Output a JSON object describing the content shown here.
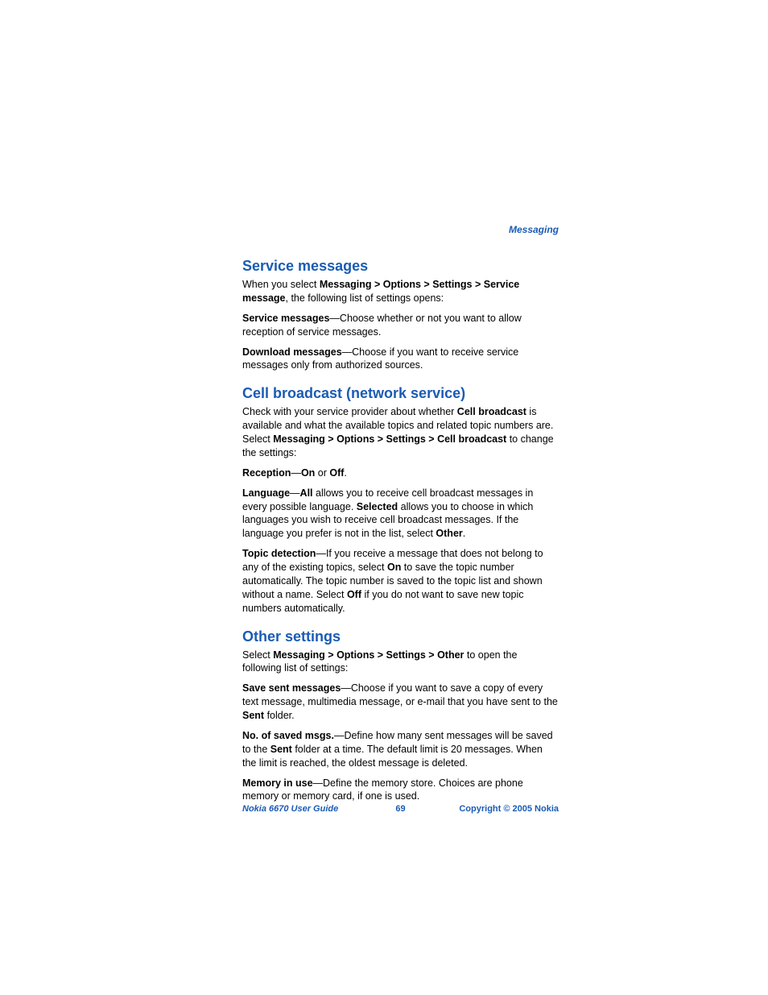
{
  "header": {
    "section": "Messaging"
  },
  "s1": {
    "title": "Service messages",
    "p1_a": "When you select ",
    "p1_b": "Messaging > Options > Settings > Service message",
    "p1_c": ", the following list of settings opens:",
    "p2_a": "Service messages",
    "p2_b": "—Choose whether or not you want to allow reception of service messages.",
    "p3_a": "Download messages",
    "p3_b": "—Choose if you want to receive service messages only from authorized sources."
  },
  "s2": {
    "title": "Cell broadcast (network service)",
    "p1_a": "Check with your service provider about whether ",
    "p1_b": "Cell broadcast",
    "p1_c": " is available and what the available topics and related topic numbers are. Select ",
    "p1_d": "Messaging > Options > Settings > Cell broadcast",
    "p1_e": " to change the settings:",
    "p2_a": "Reception",
    "p2_b": "—",
    "p2_c": "On",
    "p2_d": " or ",
    "p2_e": "Off",
    "p2_f": ".",
    "p3_a": "Language",
    "p3_b": "—",
    "p3_c": "All",
    "p3_d": " allows you to receive cell broadcast messages in every possible language. ",
    "p3_e": "Selected",
    "p3_f": " allows you to choose in which languages you wish to receive cell broadcast messages. If the language you prefer is not in the list, select ",
    "p3_g": "Other",
    "p3_h": ".",
    "p4_a": "Topic detection",
    "p4_b": "—If you receive a message that does not belong to any of the existing topics, select ",
    "p4_c": "On",
    "p4_d": " to save the topic number automatically. The topic number is saved to the topic list and shown without a name. Select ",
    "p4_e": "Off",
    "p4_f": " if you do not want to save new topic numbers automatically."
  },
  "s3": {
    "title": "Other settings",
    "p1_a": "Select ",
    "p1_b": "Messaging > Options > Settings > Other",
    "p1_c": " to open the following list of settings:",
    "p2_a": "Save sent messages",
    "p2_b": "—Choose if you want to save a copy of every text message, multimedia message, or e-mail that you have sent to the ",
    "p2_c": "Sent",
    "p2_d": " folder.",
    "p3_a": "No. of saved msgs.",
    "p3_b": "—Define how many sent messages will be saved to the ",
    "p3_c": "Sent",
    "p3_d": " folder at a time. The default limit is 20 messages. When the limit is reached, the oldest message is deleted.",
    "p4_a": "Memory in use",
    "p4_b": "—Define the memory store. Choices are phone memory or memory card, if one is used."
  },
  "footer": {
    "left": "Nokia 6670 User Guide",
    "center": "69",
    "right": "Copyright © 2005 Nokia"
  }
}
